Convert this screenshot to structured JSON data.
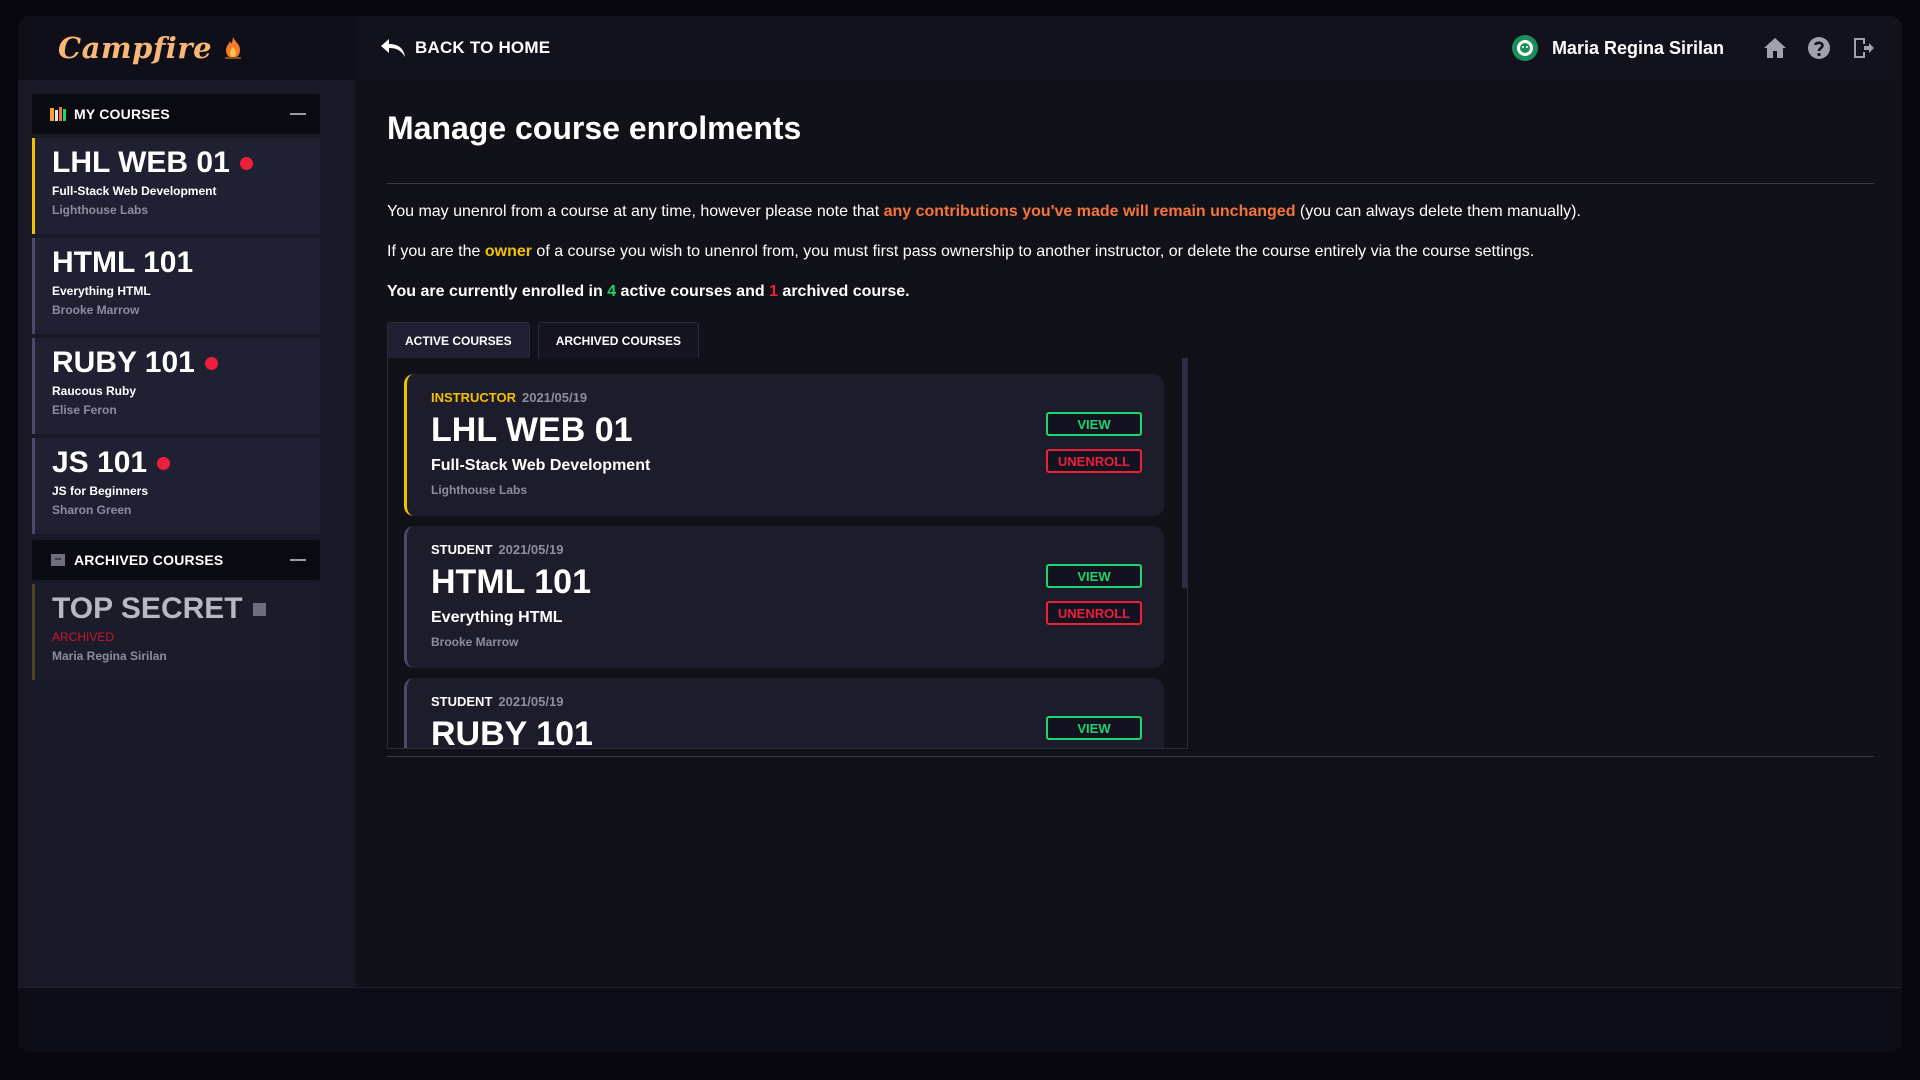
{
  "brand": {
    "name": "Campfire"
  },
  "header": {
    "back_label": "BACK TO HOME",
    "user_name": "Maria Regina Sirilan",
    "icons": [
      "home-icon",
      "help-icon",
      "logout-icon"
    ]
  },
  "sidebar": {
    "my_courses_label": "MY COURSES",
    "archived_label": "ARCHIVED COURSES",
    "courses": [
      {
        "title": "LHL WEB 01",
        "subtitle": "Full-Stack Web Development",
        "org": "Lighthouse Labs",
        "notification": true
      },
      {
        "title": "HTML 101",
        "subtitle": "Everything HTML",
        "org": "Brooke Marrow",
        "notification": false
      },
      {
        "title": "RUBY 101",
        "subtitle": "Raucous Ruby",
        "org": "Elise Feron",
        "notification": true
      },
      {
        "title": "JS 101",
        "subtitle": "JS for Beginners",
        "org": "Sharon Green",
        "notification": true
      }
    ],
    "archived_courses": [
      {
        "title": "TOP SECRET",
        "status": "ARCHIVED",
        "owner": "Maria Regina Sirilan"
      }
    ]
  },
  "main": {
    "title": "Manage course enrolments",
    "p1": {
      "before": "You may unenrol from a course at any time, however please note that ",
      "highlight": "any contributions you've made will remain unchanged",
      "after": " (you can always delete them manually)."
    },
    "p2": {
      "before": "If you are the ",
      "highlight": "owner",
      "after": " of a course you wish to unenrol from, you must first pass ownership to another instructor, or delete the course entirely via the course settings."
    },
    "p3": {
      "a": "You are currently enrolled in ",
      "active_count": "4",
      "b": " active courses and ",
      "archived_count": "1",
      "c": " archived course."
    },
    "tabs": [
      "ACTIVE COURSES",
      "ARCHIVED COURSES"
    ],
    "enrolments": [
      {
        "role": "INSTRUCTOR",
        "date": "2021/05/19",
        "title": "LHL WEB 01",
        "subtitle": "Full-Stack Web Development",
        "org": "Lighthouse Labs"
      },
      {
        "role": "STUDENT",
        "date": "2021/05/19",
        "title": "HTML 101",
        "subtitle": "Everything HTML",
        "org": "Brooke Marrow"
      },
      {
        "role": "STUDENT",
        "date": "2021/05/19",
        "title": "RUBY 101",
        "subtitle": "",
        "org": ""
      }
    ],
    "view_label": "VIEW",
    "unenroll_label": "UNENROLL"
  },
  "colors": {
    "accent_yellow": "#f2c200",
    "accent_orange": "#f4743a",
    "green": "#1fd46c",
    "red": "#ee1f3b"
  }
}
